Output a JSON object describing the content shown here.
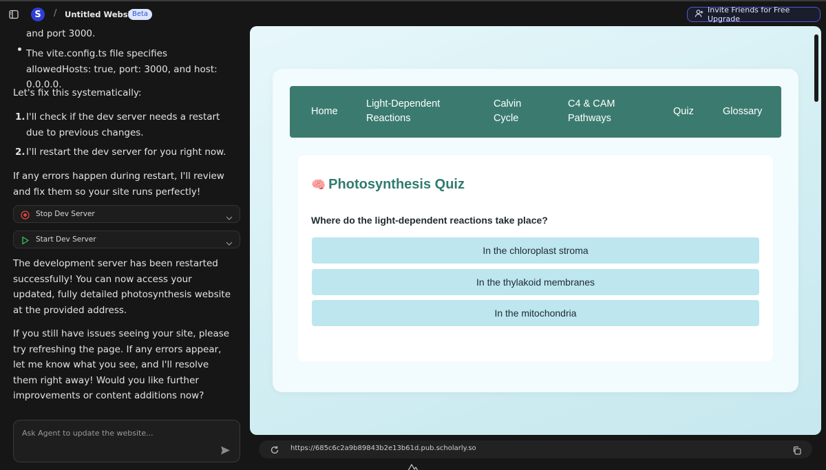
{
  "header": {
    "logo_letter": "S",
    "separator": "/",
    "site_title": "Untitled Website",
    "badge": "Beta",
    "invite_label": "Invite Friends for Free Upgrade"
  },
  "chat": {
    "line_top": "and port 3000.",
    "bullet_text": "The vite.config.ts file specifies allowedHosts: true, port: 3000, and host: 0.0.0.0.",
    "fix_intro": "Let's fix this systematically:",
    "steps": [
      {
        "num": "1.",
        "text": "I'll check if the dev server needs a restart due to previous changes."
      },
      {
        "num": "2.",
        "text": "I'll restart the dev server for you right now."
      }
    ],
    "errors_text": "If any errors happen during restart, I'll review and fix them so your site runs perfectly!",
    "tools": [
      {
        "label": "Stop Dev Server",
        "icon": "stop-icon"
      },
      {
        "label": "Start Dev Server",
        "icon": "play-icon"
      }
    ],
    "restart_text": "The development server has been restarted successfully! You can now access your updated, fully detailed photosynthesis website at the provided address.",
    "issues_text": "If you still have issues seeing your site, please try refreshing the page. If any errors appear, let me know what you see, and I'll resolve them right away! Would you like further improvements or content additions now?",
    "input_placeholder": "Ask Agent to update the website..."
  },
  "preview": {
    "nav": [
      "Home",
      "Light-Dependent Reactions",
      "Calvin Cycle",
      "C4 & CAM Pathways",
      "Quiz",
      "Glossary"
    ],
    "quiz_icon": "🧠",
    "quiz_title": "Photosynthesis Quiz",
    "question": "Where do the light-dependent reactions take place?",
    "options": [
      "In the chloroplast stroma",
      "In the thylakoid membranes",
      "In the mitochondria"
    ]
  },
  "urlbar": {
    "url": "https://685c6c2a9b89843b2e13b61d.pub.scholarly.so"
  },
  "colors": {
    "nav_bg": "#3b7b6f",
    "title": "#2f7b6f",
    "option_bg": "#bde6ef",
    "accent": "#4a5bd6"
  }
}
